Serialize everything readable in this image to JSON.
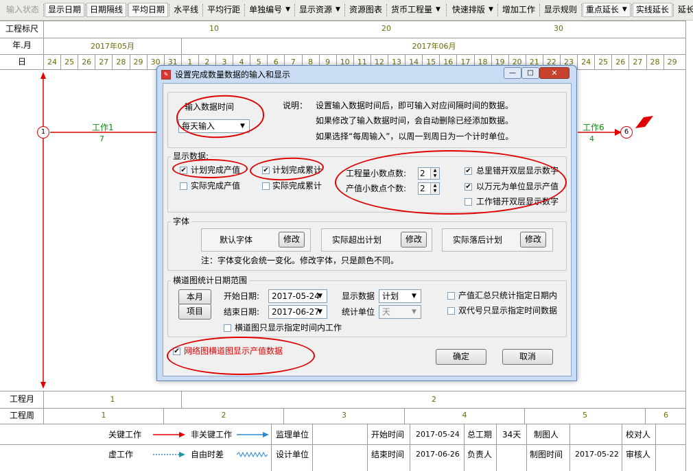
{
  "toolbar": {
    "items": [
      {
        "label": "输入状态",
        "state": "dis"
      },
      {
        "label": "显示日期",
        "state": "on"
      },
      {
        "label": "日期隔线",
        "state": "on"
      },
      {
        "label": "平均日期",
        "state": "on"
      },
      {
        "label": "水平线",
        "state": ""
      },
      {
        "label": "平均行距",
        "state": ""
      },
      {
        "label": "单独编号",
        "state": "",
        "dd": "▼"
      },
      {
        "label": "显示资源",
        "state": "",
        "dd": "▼"
      },
      {
        "label": "资源图表",
        "state": ""
      },
      {
        "label": "货币工程量",
        "state": "",
        "dd": "▼"
      },
      {
        "sep": true
      },
      {
        "label": "快速排版",
        "state": "",
        "dd": "▼"
      },
      {
        "label": "增加工作",
        "state": ""
      },
      {
        "label": "显示规则",
        "state": ""
      },
      {
        "label": "重点延长",
        "state": "on",
        "dd": "▼"
      },
      {
        "label": "实线延长",
        "state": "on"
      },
      {
        "label": "延长设置",
        "state": ""
      }
    ]
  },
  "header": {
    "scale_label": "工程标尺",
    "ym_label": "年.月",
    "day_label": "日",
    "scale_marks": [
      "10",
      "20",
      "30"
    ],
    "months": [
      "2017年05月",
      "2017年06月"
    ],
    "days": [
      "24",
      "25",
      "26",
      "27",
      "28",
      "29",
      "30",
      "31",
      "1",
      "2",
      "3",
      "4",
      "5",
      "6",
      "7",
      "8",
      "9",
      "10",
      "11",
      "12",
      "13",
      "14",
      "15",
      "16",
      "17",
      "18",
      "19",
      "20",
      "21",
      "22",
      "23",
      "24",
      "25",
      "26",
      "27",
      "28",
      "29"
    ]
  },
  "network": {
    "node_start": "1",
    "node_end": "6",
    "work1_name": "工作1",
    "work1_dur": "7",
    "work6_name": "工作6",
    "work6_dur": "4"
  },
  "bottom": {
    "month_label": "工程月",
    "month_vals": [
      "1",
      "2"
    ],
    "week_label": "工程周",
    "week_vals": [
      "1",
      "2",
      "3",
      "4",
      "5",
      "6"
    ]
  },
  "legend": {
    "critical": "关键工作",
    "noncritical": "非关键工作",
    "dummy": "虚工作",
    "float": "自由时差",
    "supervisor": "监理单位",
    "designer": "设计单位",
    "start_label": "开始时间",
    "start_val": "2017-05-24",
    "end_label": "结束时间",
    "end_val": "2017-06-26",
    "duration_label": "总工期",
    "duration_val": "34天",
    "owner_label": "负责人",
    "maker_label": "制图人",
    "make_time_label": "制图时间",
    "make_time_val": "2017-05-22",
    "checker_label": "校对人",
    "reviewer_label": "审核人"
  },
  "dialog": {
    "title": "设置完成数量数据的输入和显示",
    "controls": [
      "—",
      "□",
      "✕"
    ],
    "input_time_label": "输入数据时间",
    "input_time_value": "每天输入",
    "notes": [
      "说明：",
      "设置输入数据时间后，即可输入对应间隔时间的数据。",
      "如果修改了输入数据时间，会自动删除已经添加数据。",
      "如果选择“每周输入”，以周一到周日为一个计时单位。"
    ],
    "display_group": "显示数据:",
    "cb_plan_value": "计划完成产值",
    "cb_plan_cum": "计划完成累计",
    "cb_act_value": "实际完成产值",
    "cb_act_cum": "实际完成累计",
    "qty_decimal_label": "工程量小数点数:",
    "qty_decimal": "2",
    "val_decimal_label": "产值小数点个数:",
    "val_decimal": "2",
    "cb_total_layer": "总里错开双层显示数字",
    "cb_wan": "以万元为单位显示产值",
    "cb_work_layer": "工作错开双层显示数字",
    "font_group": "字体",
    "font_default": "默认字体",
    "font_over": "实际超出计划",
    "font_behind": "实际落后计划",
    "modify": "修改",
    "font_note": "注：字体变化会统一变化。修改字体，只是颜色不同。",
    "range_group": "横道图统计日期范围",
    "btn_month": "本月",
    "btn_project": "项目",
    "start_date_label": "开始日期:",
    "start_date": "2017-05-24",
    "end_date_label": "结束日期:",
    "end_date": "2017-06-27",
    "show_data_label": "显示数据",
    "show_data": "计划",
    "stat_unit_label": "统计单位",
    "stat_unit": "天",
    "cb_value_sum": "产值汇总只统计指定日期内",
    "cb_dual_code": "双代号只显示指定时间数据",
    "cb_bar_range": "横道图只显示指定时间内工作",
    "cb_network_value": "网络图横道图显示产值数据",
    "ok": "确定",
    "cancel": "取消"
  },
  "colors": {
    "accent_red": "#e00000",
    "olive": "#6b6b0a",
    "arrow_blue": "#2a8ad8"
  }
}
